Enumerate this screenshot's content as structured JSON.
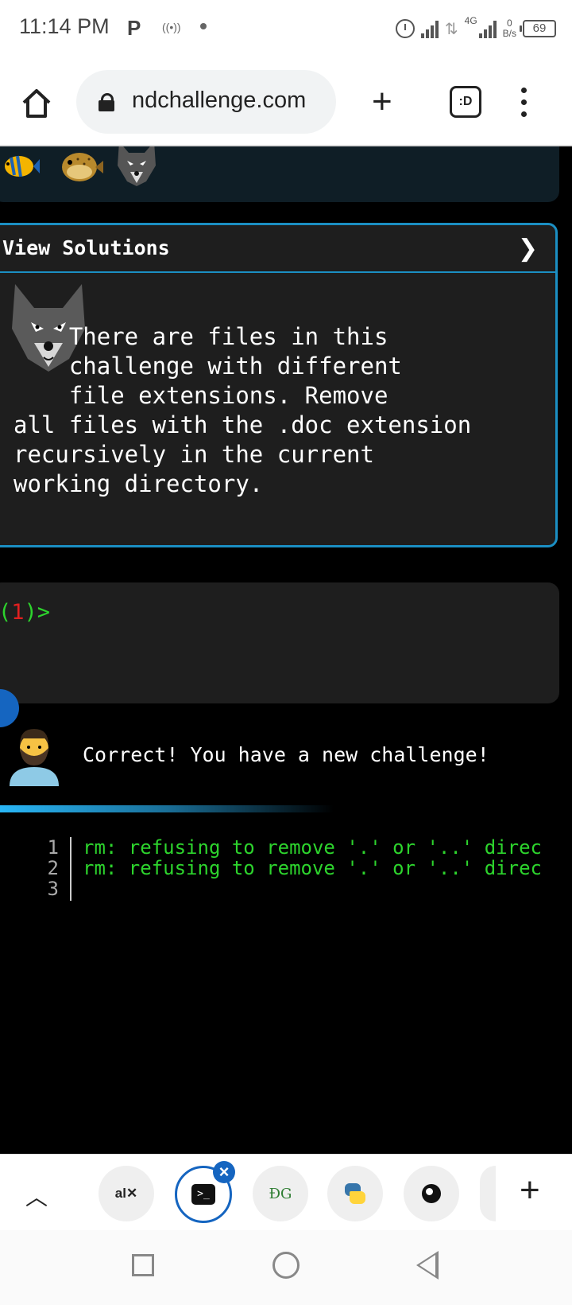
{
  "status_bar": {
    "time": "11:14 PM",
    "network_label": "4G",
    "speed_value": "0",
    "speed_unit": "B/s",
    "battery": "69"
  },
  "browser": {
    "url": "ndchallenge.com",
    "tabs_label": ":D"
  },
  "challenge": {
    "header": "View Solutions",
    "chevron": "❯",
    "text_lines": [
      "    There are files in this",
      "    challenge with different",
      "    file extensions. Remove",
      "all files with the .doc extension",
      "recursively in the current",
      "working directory."
    ]
  },
  "terminal": {
    "prompt_open": "(",
    "prompt_number": "1",
    "prompt_close": ")>"
  },
  "result": {
    "message": "Correct! You have a new challenge!",
    "progress_fraction": 0.58
  },
  "output": {
    "lines": [
      {
        "number": "1",
        "text": "rm: refusing to remove '.' or '..' direc"
      },
      {
        "number": "2",
        "text": "rm: refusing to remove '.' or '..' direc"
      },
      {
        "number": "3",
        "text": ""
      }
    ]
  },
  "tab_bar": {
    "tabs": [
      {
        "label": "al✕",
        "icon": "alx-icon"
      },
      {
        "label": "",
        "icon": "terminal-icon",
        "active": true
      },
      {
        "label": "ÐG",
        "icon": "gfg-icon"
      },
      {
        "label": "",
        "icon": "python-icon"
      },
      {
        "label": "",
        "icon": "globe-icon"
      }
    ]
  },
  "colors": {
    "accent_blue": "#1b8fc3",
    "terminal_green": "#2dd42d",
    "prompt_red": "#e02020",
    "panel_bg": "#1e1e1e"
  }
}
